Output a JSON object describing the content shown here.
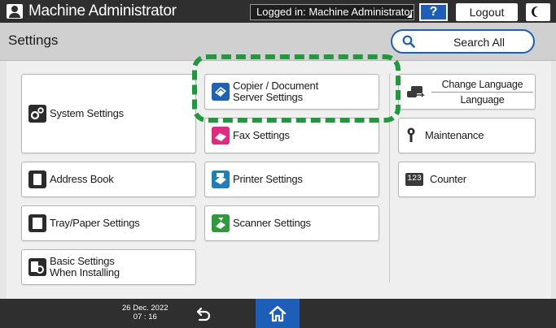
{
  "topbar": {
    "user": "Machine Administrator",
    "login_status": "Logged in: Machine Administrator",
    "help_label": "?",
    "logout_label": "Logout"
  },
  "header": {
    "title": "Settings",
    "search_label": "Search All"
  },
  "tiles": {
    "system": "System Settings",
    "address": "Address Book",
    "tray": "Tray/Paper Settings",
    "basic_1": "Basic Settings",
    "basic_2": "When Installing",
    "copier_1": "Copier / Document",
    "copier_2": "Server Settings",
    "fax": "Fax Settings",
    "printer": "Printer Settings",
    "scanner": "Scanner Settings",
    "lang_top": "Change Language",
    "lang_bottom": "Language",
    "maintenance": "Maintenance",
    "counter": "Counter",
    "counter_icon_text": "123"
  },
  "bottombar": {
    "date": "26 Dec. 2022",
    "time": "07 : 16"
  },
  "colors": {
    "accent": "#1d5fb8",
    "highlight": "#1e9a3a",
    "fax": "#e0297f",
    "scanner": "#2f9b3c"
  }
}
